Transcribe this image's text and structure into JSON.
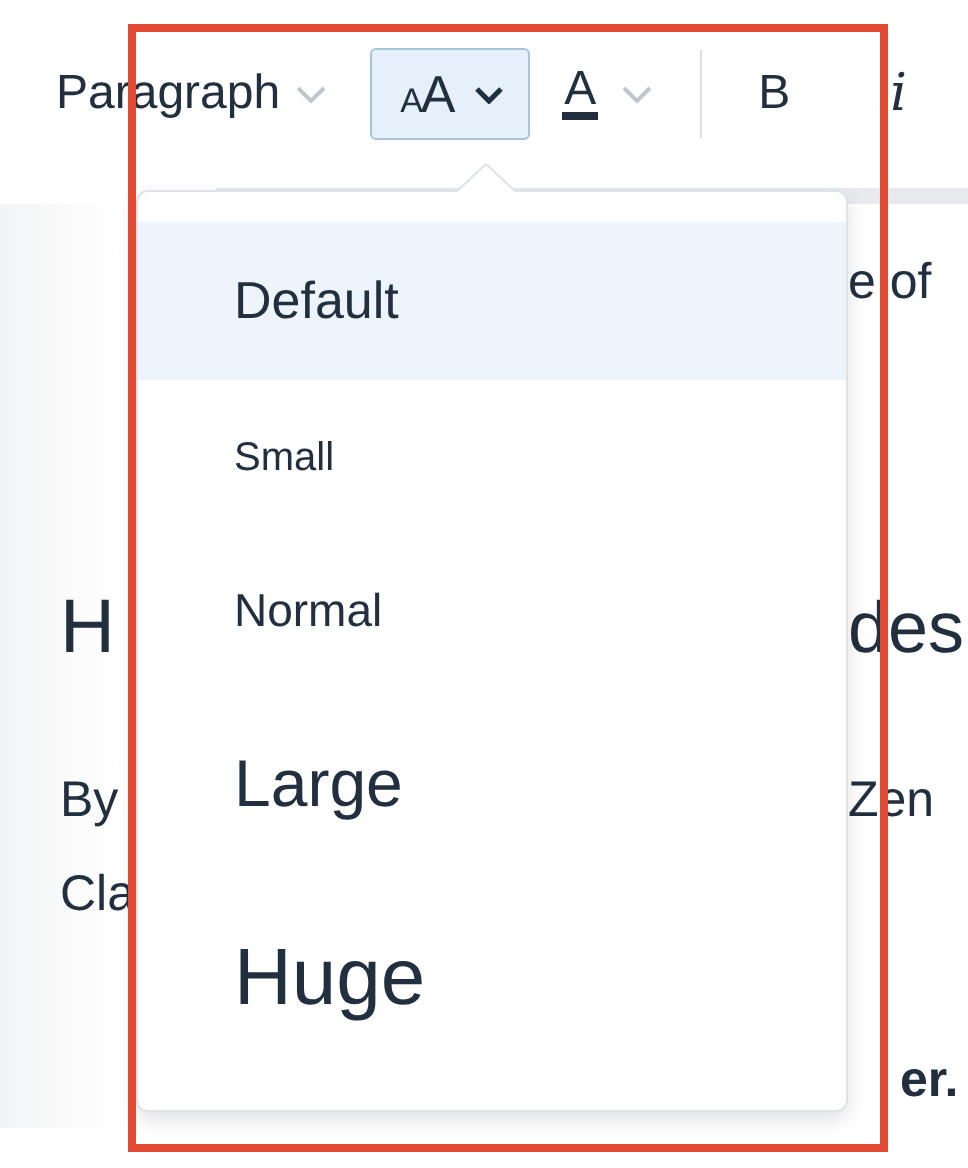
{
  "toolbar": {
    "block_format": {
      "label": "Paragraph"
    },
    "font_size_button": {
      "glyph": "AA",
      "expanded": true
    },
    "font_color_button": {
      "glyph": "A"
    },
    "bold_button": {
      "label": "B"
    },
    "italic_button": {
      "label": "i"
    }
  },
  "document": {
    "lines": [
      {
        "kind": "text",
        "right": "e of"
      },
      {
        "kind": "heading",
        "left": "H",
        "right": "des"
      },
      {
        "kind": "text",
        "left": "By",
        "right": "Zen"
      },
      {
        "kind": "text",
        "left": "Cla"
      },
      {
        "kind": "bold",
        "right": "er."
      }
    ]
  },
  "font_size_menu": {
    "items": [
      {
        "label": "Default",
        "kind": "default",
        "selected": true
      },
      {
        "label": "Small",
        "kind": "small",
        "selected": false
      },
      {
        "label": "Normal",
        "kind": "normal",
        "selected": false
      },
      {
        "label": "Large",
        "kind": "large",
        "selected": false
      },
      {
        "label": "Huge",
        "kind": "huge",
        "selected": false
      }
    ]
  }
}
